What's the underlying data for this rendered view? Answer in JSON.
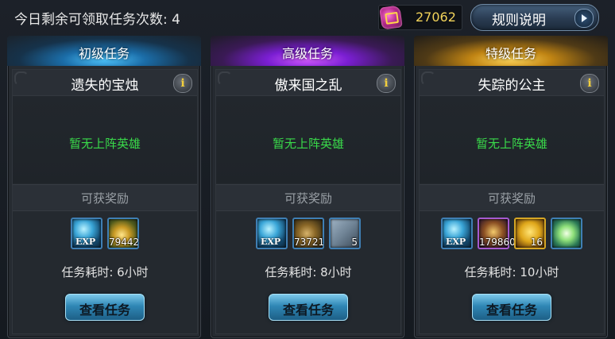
{
  "header": {
    "remaining_tasks_text": "今日剩余可领取任务次数: 4",
    "currency_icon": "gem-icon",
    "currency_value": "27062",
    "rules_button_label": "规则说明"
  },
  "labels": {
    "no_hero": "暂无上阵英雄",
    "rewards_title": "可获奖励",
    "view_button": "查看任务"
  },
  "cards": [
    {
      "tier_label": "初级任务",
      "tier_color": "#3fb6f0",
      "title": "遗失的宝烛",
      "duration": "任务耗时: 6小时",
      "rewards": [
        {
          "icon": "exp-icon",
          "qty": "EXP"
        },
        {
          "icon": "gold-pile-icon",
          "qty": "79442"
        }
      ]
    },
    {
      "tier_label": "高级任务",
      "tier_color": "#b44cf0",
      "title": "傲来国之乱",
      "duration": "任务耗时: 8小时",
      "rewards": [
        {
          "icon": "exp-icon",
          "qty": "EXP"
        },
        {
          "icon": "gold-ingot-icon",
          "qty": "73721"
        },
        {
          "icon": "scroll-icon",
          "qty": "5"
        }
      ]
    },
    {
      "tier_label": "特级任务",
      "tier_color": "#f0b93a",
      "title": "失踪的公主",
      "duration": "任务耗时: 10小时",
      "rewards": [
        {
          "icon": "exp-icon",
          "qty": "EXP"
        },
        {
          "icon": "treasure-chest-icon",
          "qty": "179860"
        },
        {
          "icon": "golden-totem-icon",
          "qty": "16"
        },
        {
          "icon": "peach-icon",
          "qty": ""
        }
      ]
    }
  ]
}
